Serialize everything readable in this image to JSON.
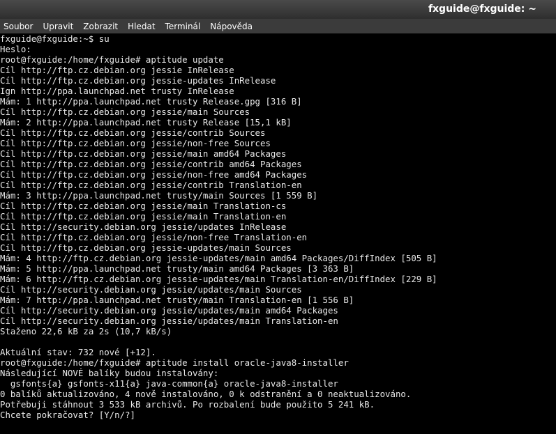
{
  "window": {
    "title": "fxguide@fxguide: ~"
  },
  "menubar": {
    "items": [
      {
        "label": "Soubor"
      },
      {
        "label": "Upravit"
      },
      {
        "label": "Zobrazit"
      },
      {
        "label": "Hledat"
      },
      {
        "label": "Terminál"
      },
      {
        "label": "Nápověda"
      }
    ]
  },
  "terminal": {
    "lines": [
      "fxguide@fxguide:~$ su",
      "Heslo:",
      "root@fxguide:/home/fxguide# aptitude update",
      "Cíl http://ftp.cz.debian.org jessie InRelease",
      "Cíl http://ftp.cz.debian.org jessie-updates InRelease",
      "Ign http://ppa.launchpad.net trusty InRelease",
      "Mám: 1 http://ppa.launchpad.net trusty Release.gpg [316 B]",
      "Cíl http://ftp.cz.debian.org jessie/main Sources",
      "Mám: 2 http://ppa.launchpad.net trusty Release [15,1 kB]",
      "Cíl http://ftp.cz.debian.org jessie/contrib Sources",
      "Cíl http://ftp.cz.debian.org jessie/non-free Sources",
      "Cíl http://ftp.cz.debian.org jessie/main amd64 Packages",
      "Cíl http://ftp.cz.debian.org jessie/contrib amd64 Packages",
      "Cíl http://ftp.cz.debian.org jessie/non-free amd64 Packages",
      "Cíl http://ftp.cz.debian.org jessie/contrib Translation-en",
      "Mám: 3 http://ppa.launchpad.net trusty/main Sources [1 559 B]",
      "Cíl http://ftp.cz.debian.org jessie/main Translation-cs",
      "Cíl http://ftp.cz.debian.org jessie/main Translation-en",
      "Cíl http://security.debian.org jessie/updates InRelease",
      "Cíl http://ftp.cz.debian.org jessie/non-free Translation-en",
      "Cíl http://ftp.cz.debian.org jessie-updates/main Sources",
      "Mám: 4 http://ftp.cz.debian.org jessie-updates/main amd64 Packages/DiffIndex [505 B]",
      "Mám: 5 http://ppa.launchpad.net trusty/main amd64 Packages [3 363 B]",
      "Mám: 6 http://ftp.cz.debian.org jessie-updates/main Translation-en/DiffIndex [229 B]",
      "Cíl http://security.debian.org jessie/updates/main Sources",
      "Mám: 7 http://ppa.launchpad.net trusty/main Translation-en [1 556 B]",
      "Cíl http://security.debian.org jessie/updates/main amd64 Packages",
      "Cíl http://security.debian.org jessie/updates/main Translation-en",
      "Staženo 22,6 kB za 2s (10,7 kB/s)",
      "",
      "Aktuální stav: 732 nové [+12].",
      "root@fxguide:/home/fxguide# aptitude install oracle-java8-installer",
      "Následující NOVÉ balíky budou instalovány:",
      "  gsfonts{a} gsfonts-x11{a} java-common{a} oracle-java8-installer",
      "0 balíků aktualizováno, 4 nově instalováno, 0 k odstranění a 0 neaktualizováno.",
      "Potřebuji stáhnout 3 533 kB archivů. Po rozbalení bude použito 5 241 kB.",
      "Chcete pokračovat? [Y/n/?]"
    ]
  }
}
